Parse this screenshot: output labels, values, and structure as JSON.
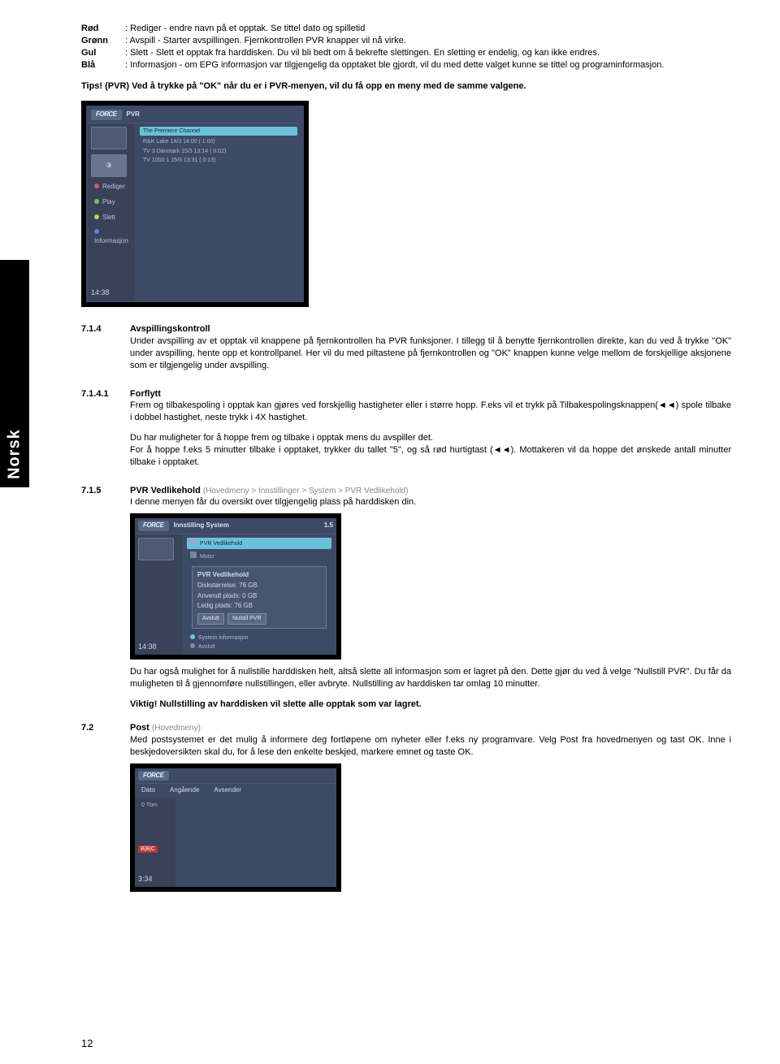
{
  "sideTab": "Norsk",
  "pageNumber": "12",
  "colors": {
    "rod": {
      "label": "Rød",
      "text": ": Rediger - endre navn på et opptak. Se tittel dato og spilletid"
    },
    "gronn": {
      "label": "Grønn",
      "text": ": Avspill - Starter avspillingen. Fjernkontrollen PVR knapper vil nå virke."
    },
    "gul": {
      "label": "Gul",
      "text": ": Slett - Slett et opptak fra harddisken. Du vil bli bedt om å bekrefte slettingen. En sletting er endelig, og kan ikke endres."
    },
    "bla": {
      "label": "Blå",
      "text": ": Informasjon - om EPG informasjon var tilgjengelig da opptaket ble gjordt, vil du med dette valget kunne se tittel og programinformasjon."
    }
  },
  "tips": "Tips! (PVR) Ved å trykke på \"OK\" når du er i PVR-menyen, vil du få opp en meny med de samme valgene.",
  "scr1": {
    "brand": "FORCE",
    "title": "PVR",
    "hlRow": "The Premiere Channel",
    "row1a": "R&K Lake    14/3 14:00  ( 1:00)",
    "row1b": "TV 3 Danmark   15/3 13:14  ( 0:02)",
    "row2": "TV 1000 1      15/3 13:31  ( 0:13)",
    "b1": "Rediger",
    "b2": "Play",
    "b3": "Slett",
    "b4": "Informasjon",
    "time": "14:38"
  },
  "s714": {
    "num": "7.1.4",
    "title": "Avspillingskontroll",
    "text": "Under avspilling av et opptak vil knappene på fjernkontrollen ha PVR funksjoner. I tillegg til å benytte fjernkontrollen direkte, kan du ved å trykke \"OK\" under avspilling, hente opp et kontrollpanel. Her vil du med piltastene på fjernkontrollen og \"OK\" knappen kunne velge mellom de forskjellige aksjonene som er tilgjengelig under avspilling."
  },
  "s7141": {
    "num": "7.1.4.1",
    "title": "Forflytt",
    "p1": "Frem og tilbakespoling i opptak kan gjøres ved forskjellig hastigheter eller i større hopp. F.eks vil et trykk på Tilbakespolingsknappen(◄◄) spole tilbake i dobbel hastighet, neste trykk i 4X hastighet.",
    "p2": "Du har muligheter for å hoppe frem og tilbake i opptak mens du avspiller det.",
    "p3": "For å hoppe f.eks 5 minutter tilbake i opptaket, trykker du tallet \"5\", og så rød hurtigtast (◄◄).  Mottakeren vil da hoppe det ønskede antall minutter tilbake i opptaket."
  },
  "s715": {
    "num": "7.1.5",
    "title": "PVR Vedlikehold",
    "crumb": "(Hovedmeny > Innstillinger > System > PVR Vedlikehold)",
    "intro": "I denne menyen får du oversikt over tilgjengelig plass på harddisken din.",
    "after": "Du har også mulighet for å nullstille harddisken helt, altså slette all informasjon som er lagret på den.  Dette gjør du ved å velge \"Nullstill PVR\". Du får da muligheten til å gjennomføre nullstillingen, eller avbryte. Nullstilling av harddisken tar omlag 10 minutter.",
    "viktig": "Viktig! Nullstilling av harddisken vil slette alle opptak som var lagret."
  },
  "scr2": {
    "brand": "FORCE",
    "header": "Innstilling System",
    "headerNum": "1.5",
    "item1": "PVR Vedlikehold",
    "item2": "Motor",
    "panelTitle": "PVR Vedlikehold",
    "l1": "Diskstørrelse:      76   GB",
    "l2": "Anvendt plads:      0    GB",
    "l3": "Ledig plads:        76   GB",
    "btn1": "Avslutt",
    "btn2": "Nulstil PVR",
    "foot1": "System informasjon",
    "foot2": "Avslutt",
    "time": "14:38"
  },
  "s72": {
    "num": "7.2",
    "title": "Post",
    "crumb": "(Hovedmeny)",
    "text": "Med postsystemet er det mulig å informere deg fortløpene om nyheter eller f.eks ny programvare. Velg Post fra hovedmenyen og tast OK. Inne i beskjedoversikten skal du, for å lese den enkelte beskjed, markere emnet og taste OK."
  },
  "scr3": {
    "brand": "FORCE",
    "t1": "Dato",
    "t2": "Angående",
    "t3": "Avsender",
    "side": "0 Tbm",
    "bbc": "B|B|C",
    "time": "3:34"
  }
}
